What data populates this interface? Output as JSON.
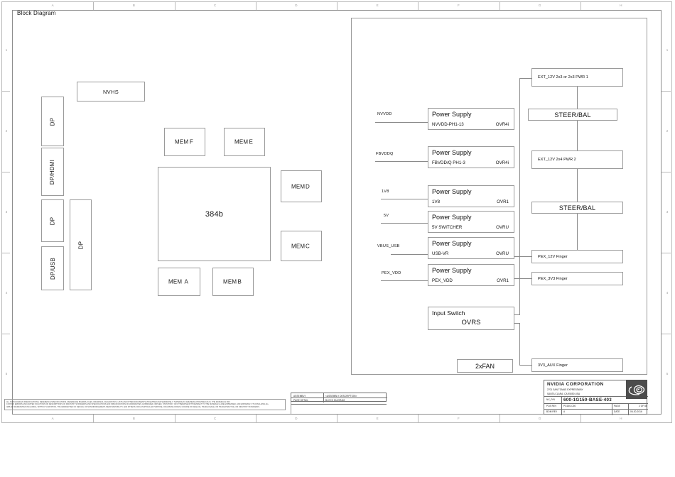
{
  "sheet": {
    "title": "Block Diagram",
    "zones_top": [
      "A",
      "B",
      "C",
      "D",
      "E",
      "F",
      "G",
      "H"
    ],
    "zones_bottom": [
      "A",
      "B",
      "C",
      "D",
      "E",
      "F",
      "G",
      "H"
    ],
    "zones_left": [
      "1",
      "2",
      "3",
      "4",
      "5"
    ]
  },
  "display_io": [
    {
      "label": "DP"
    },
    {
      "label": "DP/HDMI"
    },
    {
      "label": "DP"
    },
    {
      "label": "DP/USB"
    },
    {
      "label": "DP"
    }
  ],
  "nvhs": {
    "label": "NVHS"
  },
  "core": {
    "label": "384b"
  },
  "memories": [
    {
      "prefix": "MEM",
      "bank": "F"
    },
    {
      "prefix": "MEM",
      "bank": "E"
    },
    {
      "prefix": "MEM",
      "bank": "D"
    },
    {
      "prefix": "MEM",
      "bank": "C"
    },
    {
      "prefix": "MEM",
      "bank": "A"
    },
    {
      "prefix": "MEM",
      "bank": "B"
    }
  ],
  "power_supplies": [
    {
      "net": "NVVDD",
      "title": "Power Supply",
      "rail": "NVVDD-PH1-13",
      "ovr": "OVR4i"
    },
    {
      "net": "FBVDDQ",
      "title": "Power Supply",
      "rail": "FBVDD/Q PH1-3",
      "ovr": "OVR4i"
    },
    {
      "net": "1V8",
      "title": "Power Supply",
      "rail": "1V8",
      "ovr": "OVR1"
    },
    {
      "net": "5V",
      "title": "Power Supply",
      "rail": "5V SWITCHER",
      "ovr": "OVRU"
    },
    {
      "net": "VBUS_USB",
      "title": "Power Supply",
      "rail": "USB-VR",
      "ovr": "OVRU"
    },
    {
      "net": "PEX_VDD",
      "title": "Power Supply",
      "rail": "PEX_VDD",
      "ovr": "OVR1"
    }
  ],
  "input_switch": {
    "title": "Input Switch",
    "ovr": "OVRS"
  },
  "fan": {
    "label": "2xFAN"
  },
  "power_inputs": [
    {
      "label": "EXT_12V 2x3 or 2x3 PWR 1",
      "style": "small"
    },
    {
      "label": "STEER/BAL",
      "style": "large"
    },
    {
      "label": "EXT_12V 2x4 PWR 2",
      "style": "small"
    },
    {
      "label": "STEER/BAL",
      "style": "large"
    },
    {
      "label": "PEX_12V Finger",
      "style": "small"
    },
    {
      "label": "PEX_3V3 Finger",
      "style": "small"
    },
    {
      "label": "3V3_AUX Finger",
      "style": "small"
    }
  ],
  "title_block": {
    "company": "NVIDIA CORPORATION",
    "address1": "2701 SAN TOMAS EXPRESSWAY",
    "address2": "SANTA CLARA, CA 95050 USA",
    "pn_label": "NV_P/N",
    "pn_value": "600-1G150-BASE-403",
    "pcb_rev_label": "PCB REV",
    "pcb_rev_value": "PG150-C50",
    "bom_rev_label": "BOM REV",
    "bom_rev_value": "A",
    "page_label": "PAGE",
    "page_value": "2 OF 66",
    "date_label": "DATE",
    "date_value": "06-30-2016",
    "assembly_label": "ASSEMBLY",
    "assembly_value": "<ASSEMBLY DESCRIPTION>",
    "page_detail_label": "PAGE DETAIL",
    "page_detail_value": "BLOCK DIAGRAM",
    "logo": "nvidia-eye-logo"
  },
  "disclaimer": {
    "line1": "ALL NVIDIA DESIGN SPECIFICATIONS, REFERENCE SPECIFICATIONS, REFERENCE BOARDS, FILES, DRAWINGS, DIAGNOSTICS, LISTS AND OTHER DOCUMENTS (TOGETHER AND SEPARATELY, \"MATERIALS\") ARE BEING PROVIDED AS IS. THE MATERIALS MAY",
    "line2": "CONTAIN ERRORS AND LIMITED SOLUTIONS OR DESCRIPTIONS OF INDUSTRY STANDARDS AND SPECIFICATIONS AND SPECIFICATIONS NO WARRANTIES, EXPRESSED, IMPLIED, STATUTORY, OR OTHERWISE WITH RESPECT TO THE MATERIALS, ARE EXPRESSED, AND EXPRESSLY ITS DISCLAIMS ALL",
    "line3": "IMPLIED WARRANTIES INCLUDING, WITHOUT LIMITATION, THE WARRANTIES OF DESIGN, OF NONINFRINGEMENT, MERCHANTABILITY, AND FITNESS FOR A PARTICULAR PURPOSE, OR ARISING FROM A COURSE OF DEALING, TRADE USAGE, OR TRADE PRACTICE, OR INDUSTRY STANDARDS."
  }
}
